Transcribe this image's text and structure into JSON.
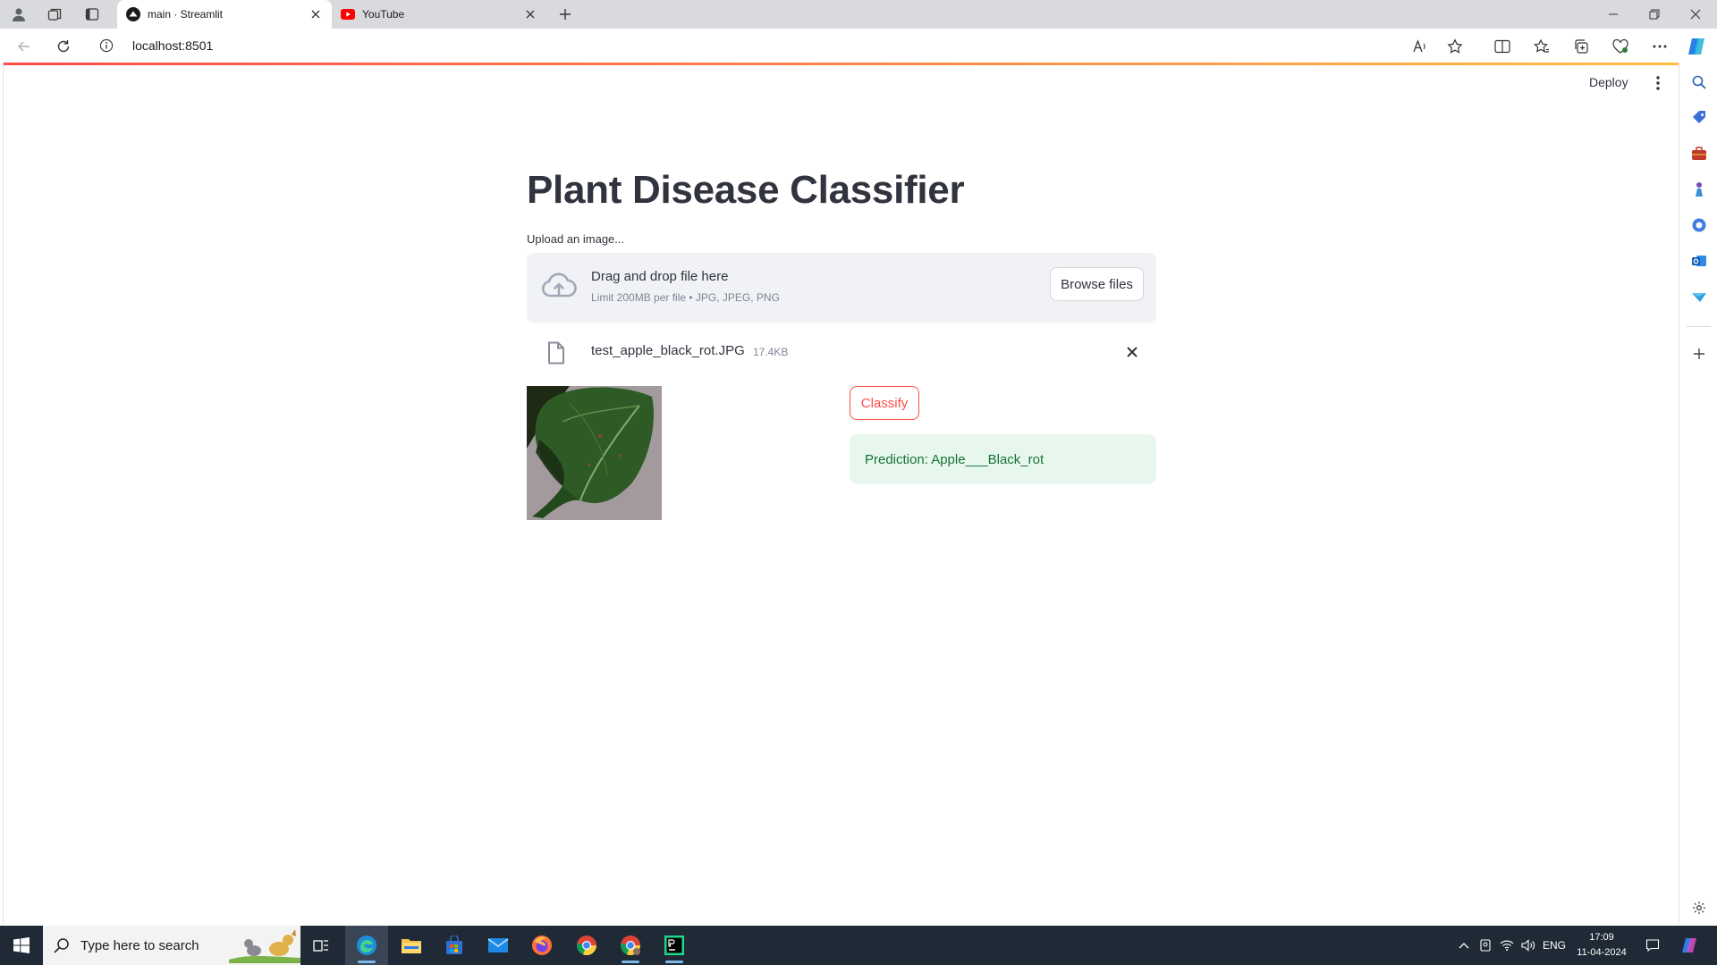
{
  "browser": {
    "tabs": [
      {
        "title": "main · Streamlit",
        "active": true
      },
      {
        "title": "YouTube",
        "active": false
      }
    ],
    "address": "localhost:8501"
  },
  "app": {
    "header": {
      "deploy_label": "Deploy"
    },
    "title": "Plant Disease Classifier",
    "uploader": {
      "label": "Upload an image...",
      "drag_text": "Drag and drop file here",
      "limit_text": "Limit 200MB per file • JPG, JPEG, PNG",
      "browse_label": "Browse files",
      "file": {
        "name": "test_apple_black_rot.JPG",
        "size": "17.4KB"
      }
    },
    "classify_label": "Classify",
    "prediction": "Prediction: Apple___Black_rot"
  },
  "taskbar": {
    "search_placeholder": "Type here to search",
    "language": "ENG",
    "time": "17:09",
    "date": "11-04-2024"
  },
  "colors": {
    "accent": "#ff4b4b",
    "success_bg": "#e8f7ee",
    "success_text": "#177233",
    "text": "#31333f"
  }
}
